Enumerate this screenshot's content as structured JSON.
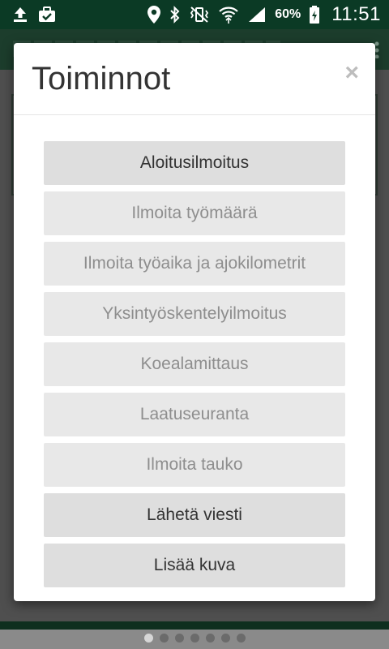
{
  "status_bar": {
    "left_icons": [
      "upload-icon",
      "briefcase-check-icon"
    ],
    "right_icons": [
      "location-icon",
      "bluetooth-icon",
      "vibrate-icon",
      "wifi-icon",
      "signal-icon",
      "battery-icon"
    ],
    "battery": "60%",
    "time": "11:51",
    "color": "#0b3a25"
  },
  "modal": {
    "title": "Toiminnot",
    "close_symbol": "×",
    "actions": [
      {
        "label": "Aloitusilmoitus",
        "enabled": true
      },
      {
        "label": "Ilmoita työmäärä",
        "enabled": false
      },
      {
        "label": "Ilmoita työaika ja ajokilometrit",
        "enabled": false
      },
      {
        "label": "Yksintyöskentelyilmoitus",
        "enabled": false
      },
      {
        "label": "Koealamittaus",
        "enabled": false
      },
      {
        "label": "Laatuseuranta",
        "enabled": false
      },
      {
        "label": "Ilmoita tauko",
        "enabled": false
      },
      {
        "label": "Lähetä viesti",
        "enabled": true
      },
      {
        "label": "Lisää kuva",
        "enabled": true
      }
    ]
  },
  "pager": {
    "count": 7,
    "active_index": 0
  }
}
